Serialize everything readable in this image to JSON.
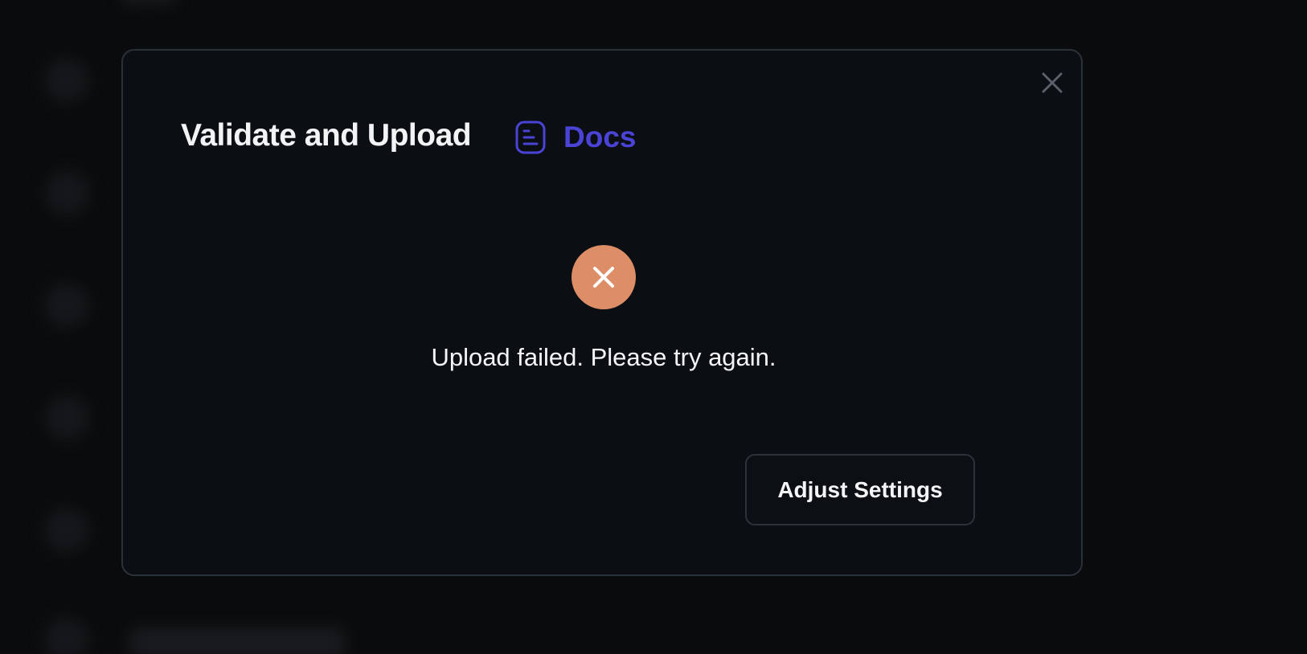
{
  "dialog": {
    "title": "Validate and Upload",
    "docs_link": {
      "label": "Docs",
      "icon": "document-icon",
      "color": "#4a43d6"
    },
    "close_icon": "close-icon",
    "status": {
      "icon": "error-x-icon",
      "color": "#dd8e67",
      "message": "Upload failed. Please try again."
    },
    "actions": {
      "adjust_settings_label": "Adjust Settings"
    }
  },
  "theme": {
    "background": "#0b0f14",
    "border": "#2b3139",
    "text": "#f2f3f5"
  }
}
